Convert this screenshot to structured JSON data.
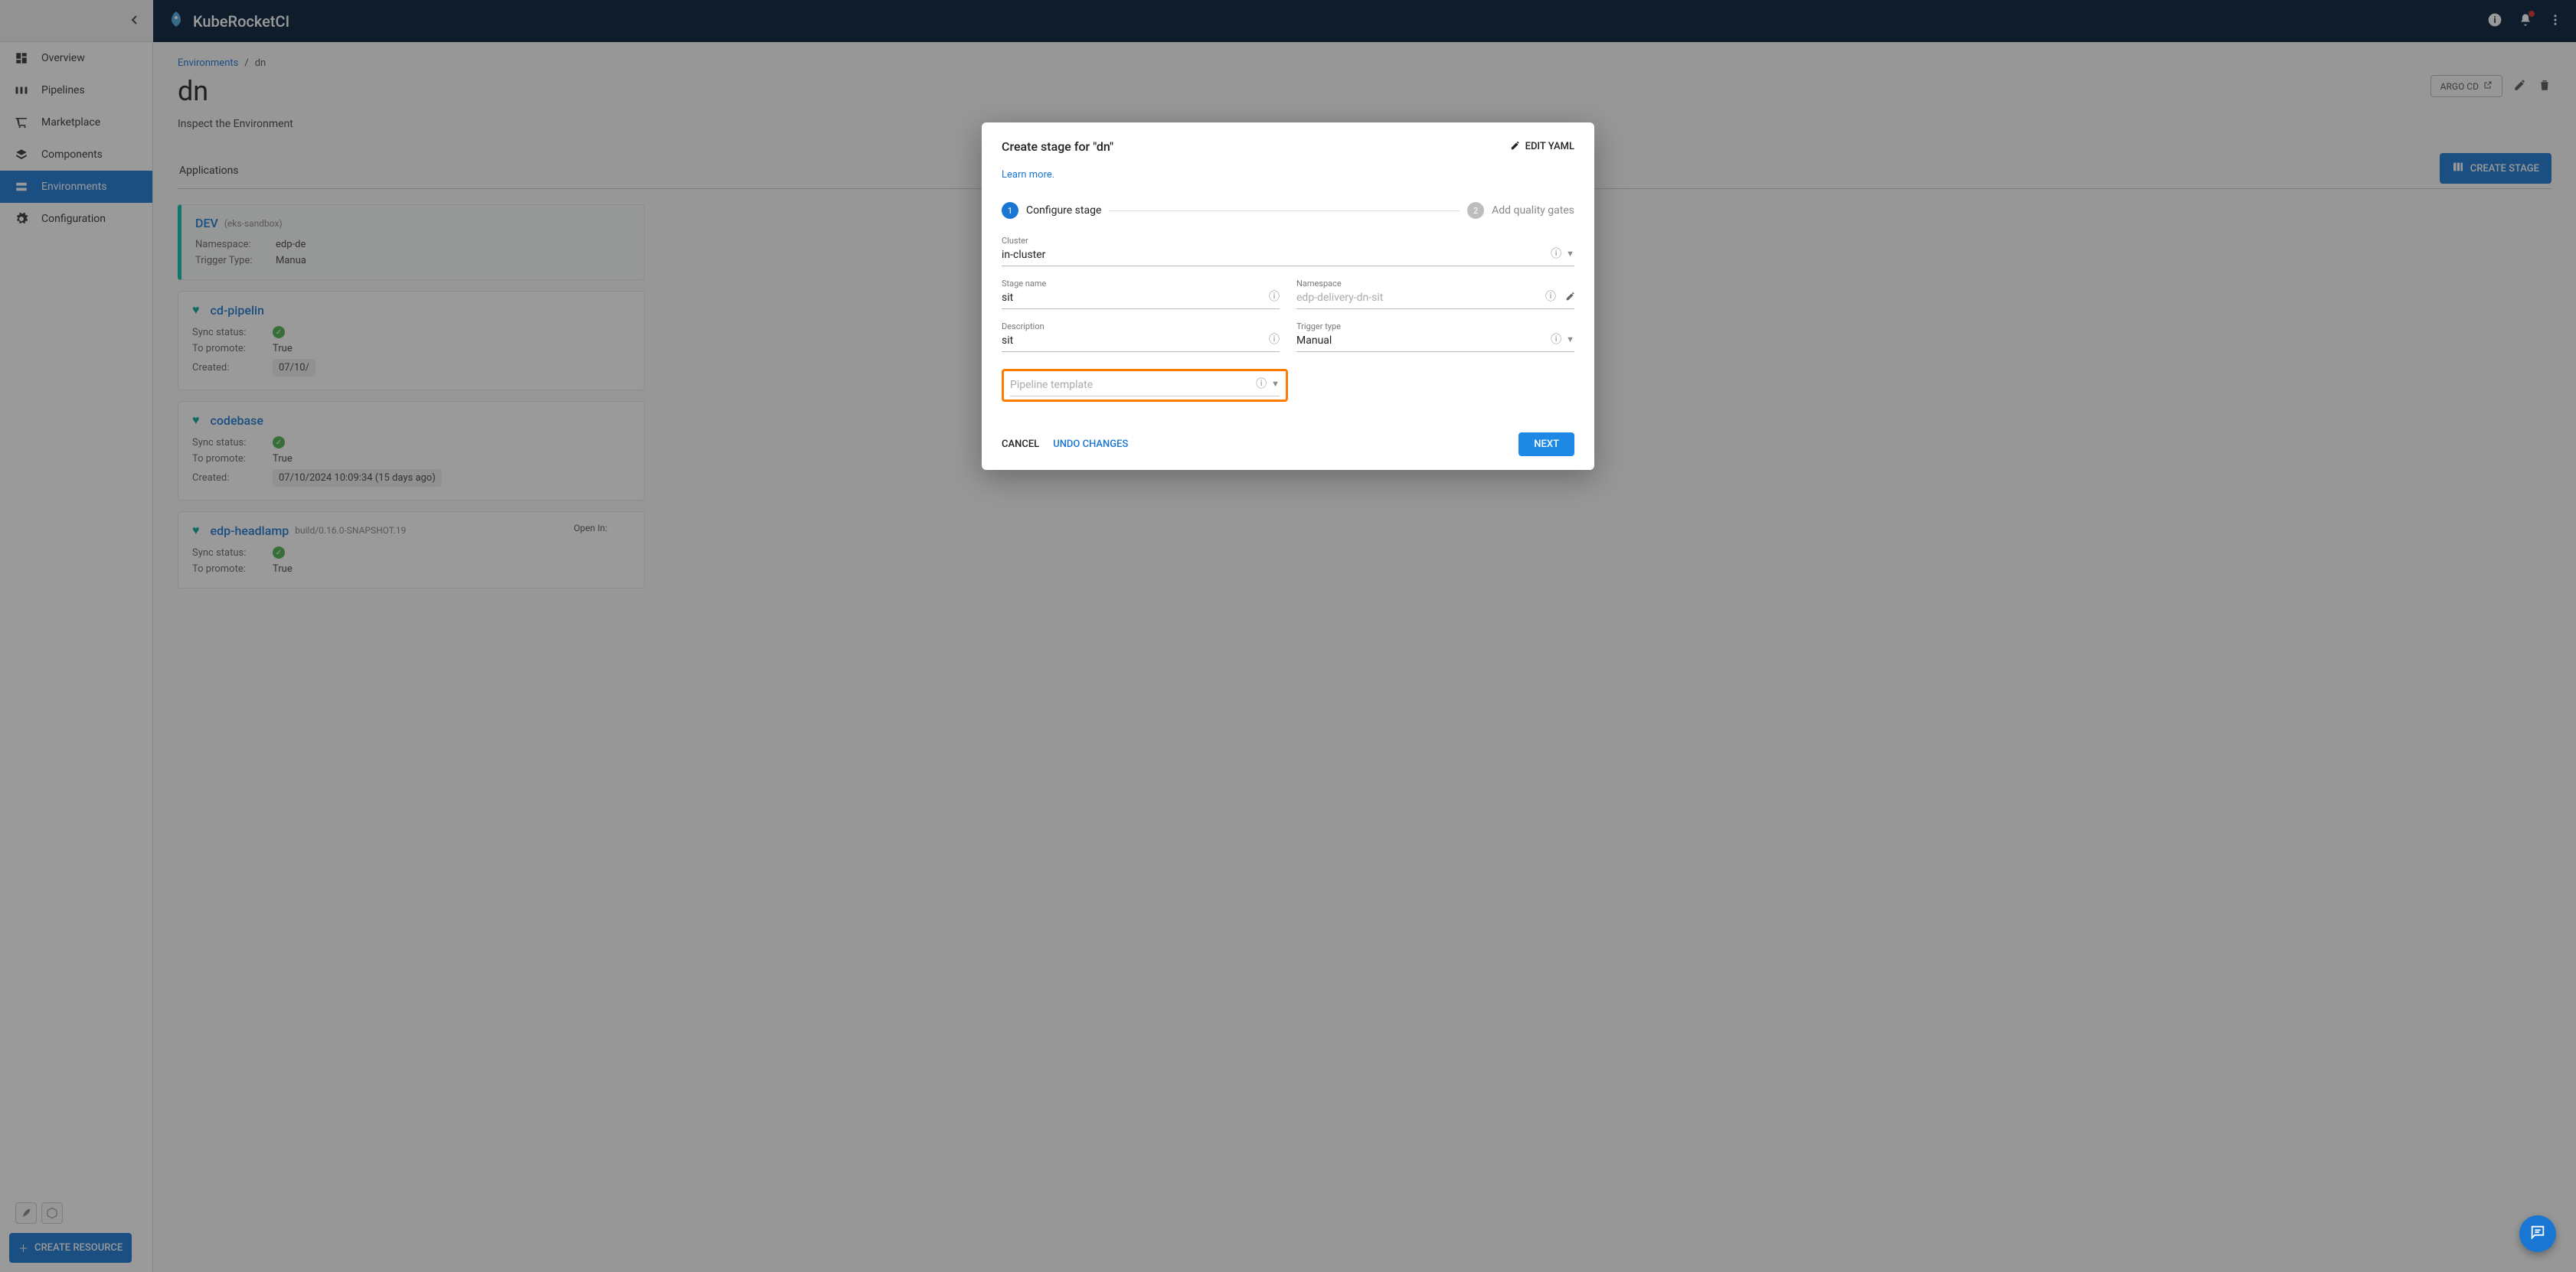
{
  "brand": "KubeRocketCI",
  "sidebar": {
    "items": [
      {
        "label": "Overview"
      },
      {
        "label": "Pipelines"
      },
      {
        "label": "Marketplace"
      },
      {
        "label": "Components"
      },
      {
        "label": "Environments"
      },
      {
        "label": "Configuration"
      }
    ],
    "create_resource_label": "CREATE RESOURCE"
  },
  "breadcrumb": {
    "root": "Environments",
    "current": "dn"
  },
  "page": {
    "title": "dn",
    "subtitle": "Inspect the Environment",
    "argo_label": "ARGO CD",
    "tab": "Applications",
    "create_stage_label": "CREATE STAGE"
  },
  "stages": [
    {
      "title": "DEV",
      "env": "(eks-sandbox)",
      "rows": {
        "namespace_label": "Namespace:",
        "namespace_value": "edp-de",
        "trigger_label": "Trigger Type:",
        "trigger_value": "Manua"
      }
    },
    {
      "title": "cd-pipelin",
      "rows": {
        "sync_label": "Sync status:",
        "promote_label": "To promote:",
        "promote_value": "True",
        "created_label": "Created:",
        "created_value": "07/10/"
      }
    },
    {
      "title": "codebase",
      "rows": {
        "sync_label": "Sync status:",
        "promote_label": "To promote:",
        "promote_value": "True",
        "created_label": "Created:",
        "created_value": "07/10/2024 10:09:34 (15 days ago)"
      }
    },
    {
      "title": "edp-headlamp",
      "snapshot": "build/0.16.0-SNAPSHOT.19",
      "openin": "Open In:",
      "rows": {
        "sync_label": "Sync status:",
        "promote_label": "To promote:",
        "promote_value": "True"
      }
    }
  ],
  "modal": {
    "title": "Create stage for \"dn\"",
    "edit_yaml": "EDIT YAML",
    "learn_more": "Learn more.",
    "step1": "Configure stage",
    "step2": "Add quality gates",
    "fields": {
      "cluster_label": "Cluster",
      "cluster_value": "in-cluster",
      "stagename_label": "Stage name",
      "stagename_value": "sit",
      "namespace_label": "Namespace",
      "namespace_value": "edp-delivery-dn-sit",
      "description_label": "Description",
      "description_value": "sit",
      "trigger_label": "Trigger type",
      "trigger_value": "Manual",
      "pipeline_placeholder": "Pipeline template"
    },
    "footer": {
      "cancel": "CANCEL",
      "undo": "UNDO CHANGES",
      "next": "NEXT"
    }
  }
}
